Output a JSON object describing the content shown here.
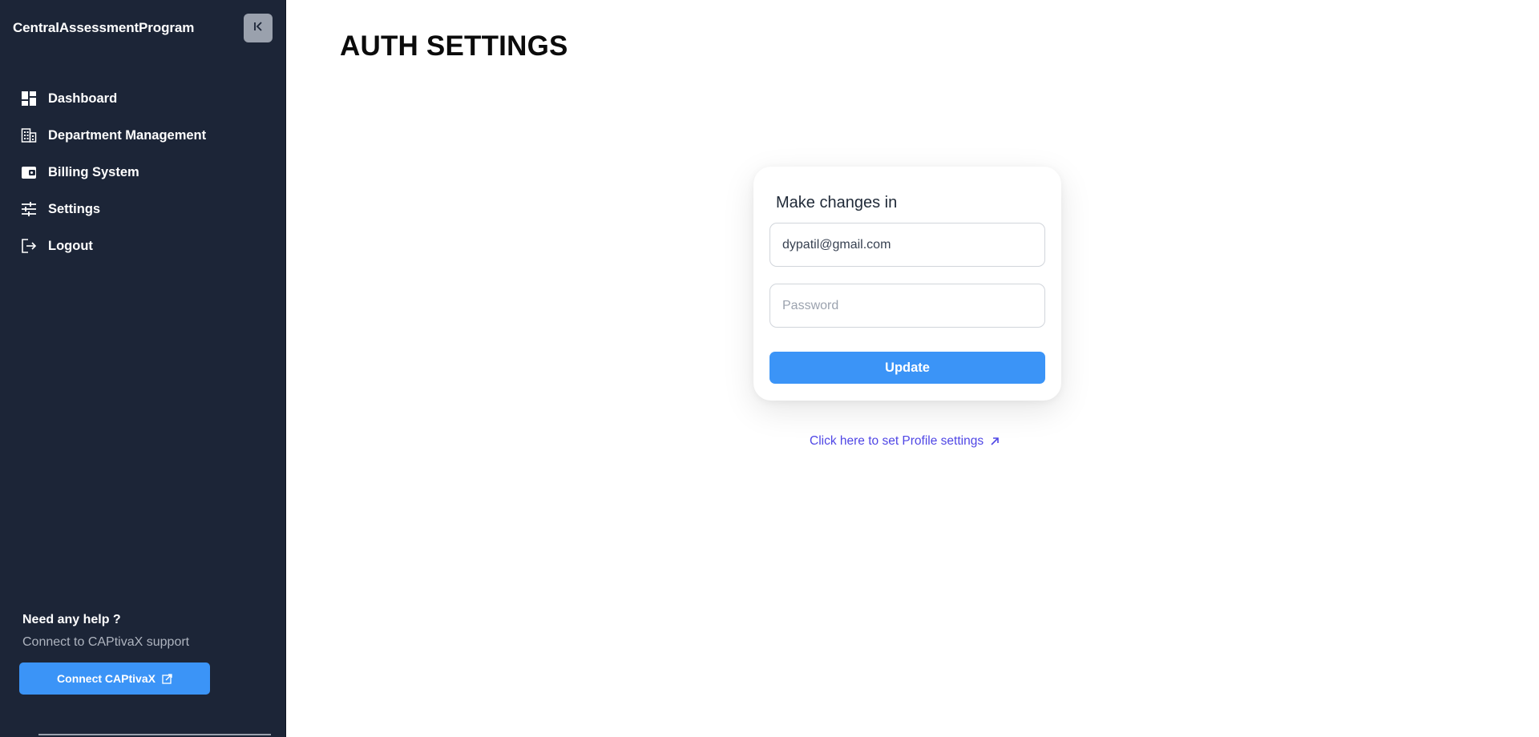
{
  "sidebar": {
    "brand": "CentralAssessmentProgram",
    "collapse_icon": "collapse-left-icon",
    "items": [
      {
        "label": "Dashboard",
        "icon": "dashboard-icon"
      },
      {
        "label": "Department Management",
        "icon": "building-icon"
      },
      {
        "label": "Billing System",
        "icon": "wallet-icon"
      },
      {
        "label": "Settings",
        "icon": "sliders-icon"
      },
      {
        "label": "Logout",
        "icon": "logout-icon"
      }
    ],
    "help": {
      "title": "Need any help ?",
      "subtitle": "Connect to CAPtivaX support",
      "button_label": "Connect CAPtivaX",
      "button_icon": "external-link-icon"
    }
  },
  "main": {
    "title": "AUTH SETTINGS",
    "card": {
      "heading": "Make changes in",
      "email_value": "dypatil@gmail.com",
      "password_placeholder": "Password",
      "update_label": "Update"
    },
    "profile_link": "Click here to set Profile settings",
    "profile_link_icon": "arrow-up-right-icon"
  },
  "colors": {
    "sidebar_bg": "#1c2537",
    "accent": "#3b94f7",
    "link": "#4f46e5"
  }
}
